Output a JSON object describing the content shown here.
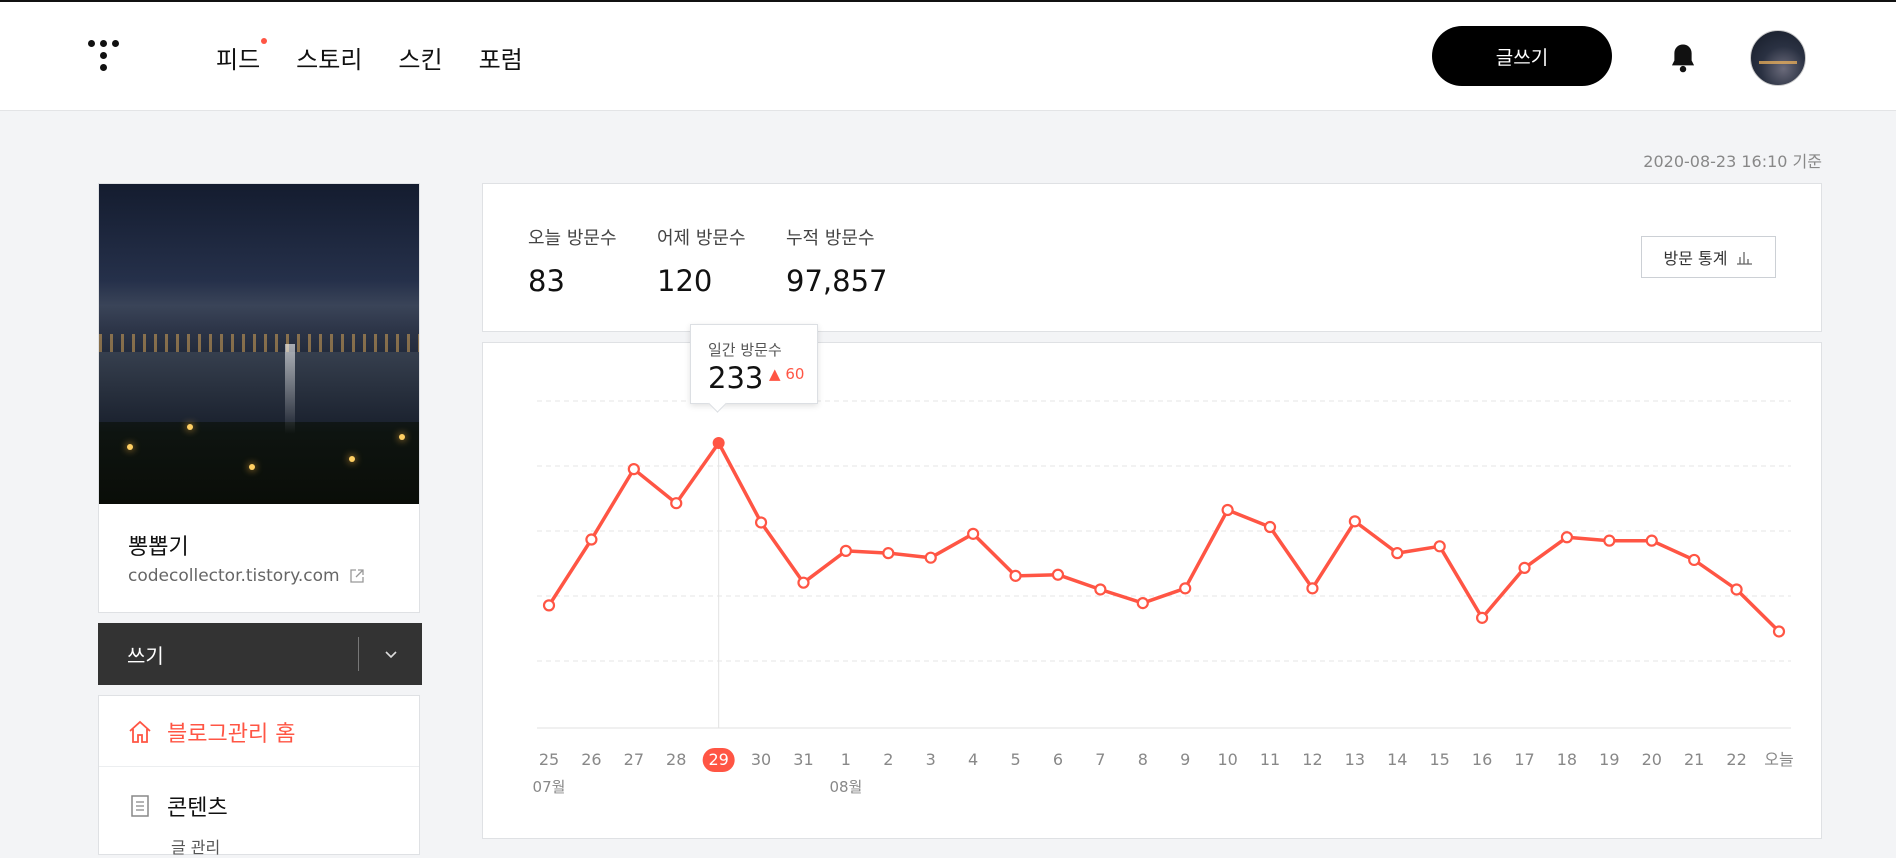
{
  "header": {
    "nav": [
      {
        "label": "피드",
        "new_badge": true
      },
      {
        "label": "스토리",
        "new_badge": false
      },
      {
        "label": "스킨",
        "new_badge": false
      },
      {
        "label": "포럼",
        "new_badge": false
      }
    ],
    "write_button": "글쓰기",
    "icons": [
      "tistory-logo-icon",
      "bell-icon",
      "avatar"
    ]
  },
  "timestamp": "2020-08-23 16:10 기준",
  "sidebar": {
    "blog_name": "뽕뽑기",
    "blog_url": "codecollector.tistory.com",
    "write_label": "쓰기",
    "menu": [
      {
        "label": "블로그관리 홈",
        "icon": "home-icon",
        "active": true
      },
      {
        "label": "콘텐츠",
        "icon": "document-icon",
        "active": false
      }
    ],
    "submenu_partial": "글 관리"
  },
  "stats": {
    "today_label": "오늘 방문수",
    "today_value": "83",
    "yesterday_label": "어제 방문수",
    "yesterday_value": "120",
    "total_label": "누적 방문수",
    "total_value": "97,857",
    "stats_button": "방문 통계"
  },
  "tooltip": {
    "label": "일간 방문수",
    "value": "233",
    "delta": "60"
  },
  "colors": {
    "accent": "#ff5544",
    "dark_bar": "#333333"
  },
  "chart_data": {
    "type": "line",
    "x": [
      "25",
      "26",
      "27",
      "28",
      "29",
      "30",
      "31",
      "1",
      "2",
      "3",
      "4",
      "5",
      "6",
      "7",
      "8",
      "9",
      "10",
      "11",
      "12",
      "13",
      "14",
      "15",
      "16",
      "17",
      "18",
      "19",
      "20",
      "21",
      "22",
      "오늘"
    ],
    "month_labels": [
      {
        "index": 0,
        "label": "07월"
      },
      {
        "index": 7,
        "label": "08월"
      }
    ],
    "series": [
      {
        "values": [
          90,
          148,
          210,
          180,
          233,
          163,
          110,
          138,
          136,
          132,
          153,
          116,
          117,
          104,
          92,
          105,
          174,
          159,
          105,
          164,
          136,
          142,
          79,
          123,
          150,
          147,
          147,
          130,
          104,
          67
        ]
      }
    ],
    "highlight_index": 4,
    "ylim": [
      -18,
      270
    ],
    "grid": true
  }
}
